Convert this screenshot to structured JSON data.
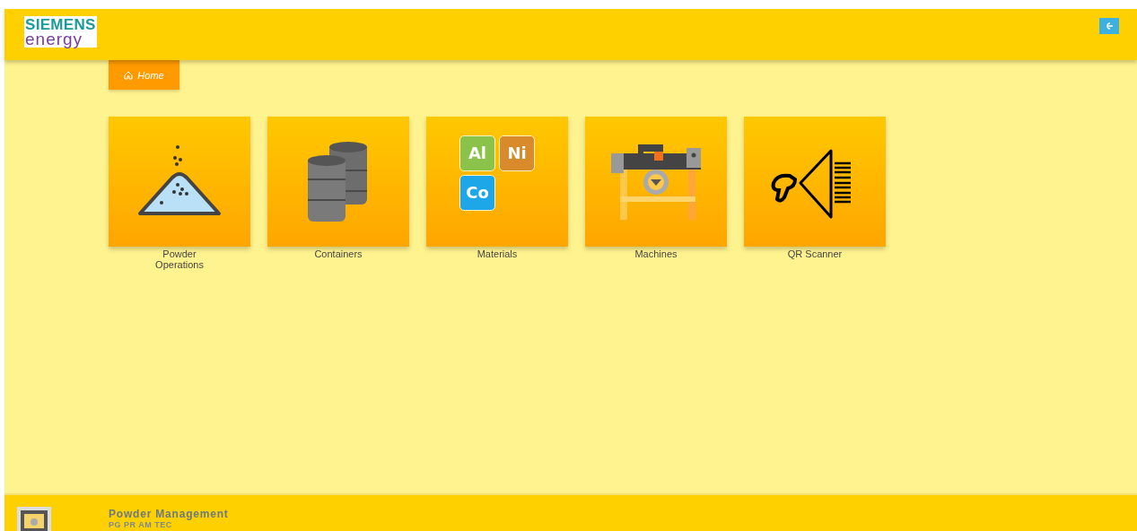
{
  "header": {
    "logo_top": "SIEMENS",
    "logo_bottom": "energy"
  },
  "breadcrumb": {
    "label": "Home"
  },
  "tiles": [
    {
      "kind": "powder",
      "label": "Powder Operations"
    },
    {
      "kind": "containers",
      "label": "Containers"
    },
    {
      "kind": "materials",
      "label": "Materials",
      "elements": [
        "Al",
        "Ni",
        "Co"
      ]
    },
    {
      "kind": "machines",
      "label": "Machines"
    },
    {
      "kind": "scanner",
      "label": "QR Scanner"
    }
  ],
  "footer": {
    "title": "Powder Management",
    "subtitle": "PG PR AM TEC"
  }
}
